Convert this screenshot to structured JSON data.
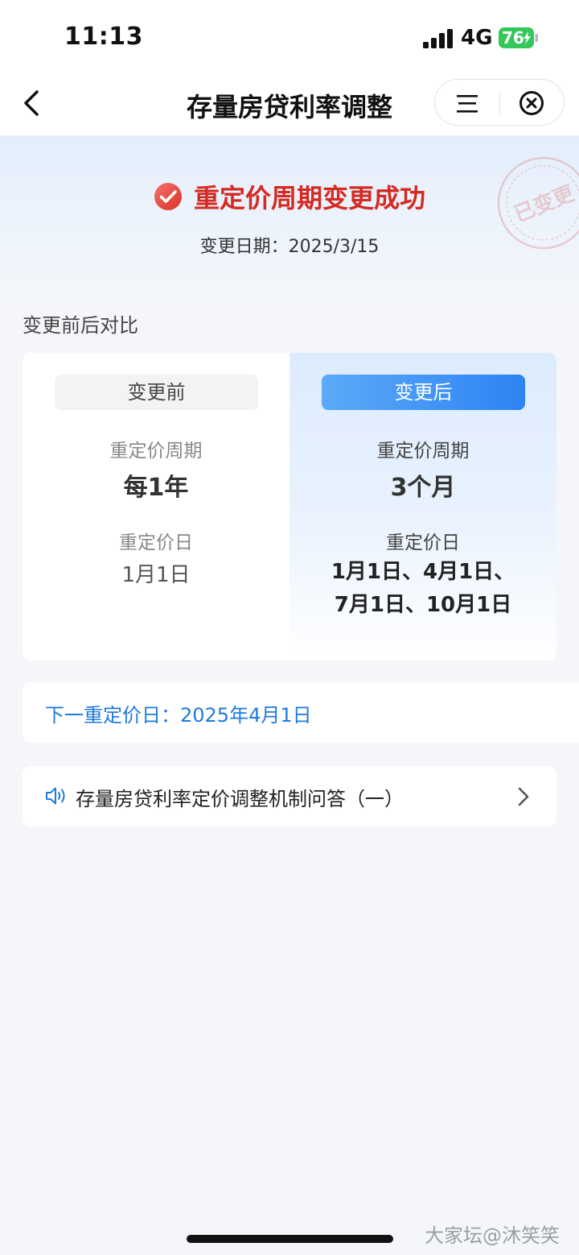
{
  "status_bar": {
    "time": "11:13",
    "network": "4G",
    "battery": "76"
  },
  "nav": {
    "title": "存量房贷利率调整"
  },
  "hero": {
    "success_text": "重定价周期变更成功",
    "change_date_label": "变更日期：",
    "change_date_value": "2025/3/15",
    "stamp_text": "已变更"
  },
  "compare": {
    "section_label": "变更前后对比",
    "before": {
      "tag": "变更前",
      "period_label": "重定价周期",
      "period_value": "每1年",
      "day_label": "重定价日",
      "day_value": "1月1日"
    },
    "after": {
      "tag": "变更后",
      "period_label": "重定价周期",
      "period_value": "3个月",
      "day_label": "重定价日",
      "day_value_line1": "1月1日、4月1日、",
      "day_value_line2": "7月1日、10月1日"
    }
  },
  "next_reprice": {
    "text": "下一重定价日：2025年4月1日"
  },
  "faq": {
    "text": "存量房贷利率定价调整机制问答（一）"
  },
  "watermark": "大家坛@沐笑笑",
  "colors": {
    "success_red": "#d42a22",
    "accent_blue": "#2d83f3",
    "link_blue": "#1f7ae0",
    "battery_green": "#34c759"
  }
}
